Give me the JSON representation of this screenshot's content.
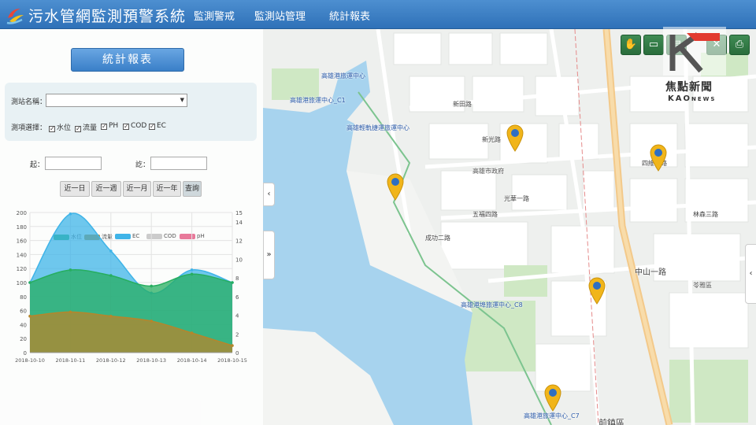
{
  "app": {
    "title": "污水管網監測預警系統"
  },
  "nav": [
    {
      "label": "監測警戒"
    },
    {
      "label": "監測站管理"
    },
    {
      "label": "統計報表"
    }
  ],
  "panel": {
    "report_button": "統計報表",
    "station_label": "測站名稱：",
    "station_value": "",
    "item_label": "測項選擇：",
    "items": [
      {
        "label": "水位",
        "checked": true
      },
      {
        "label": "流量",
        "checked": true
      },
      {
        "label": "PH",
        "checked": true
      },
      {
        "label": "COD",
        "checked": true
      },
      {
        "label": "EC",
        "checked": true
      }
    ],
    "start_label": "起：",
    "end_label": "訖：",
    "start_value": "",
    "end_value": "",
    "range_buttons": [
      {
        "label": "近一日"
      },
      {
        "label": "近一週"
      },
      {
        "label": "近一月"
      },
      {
        "label": "近一年"
      },
      {
        "label": "查詢"
      }
    ]
  },
  "chart_data": {
    "type": "area",
    "x": [
      "2018-10-10",
      "2018-10-11",
      "2018-10-12",
      "2018-10-13",
      "2018-10-14",
      "2018-10-15"
    ],
    "y_left_ticks": [
      0,
      20,
      40,
      60,
      80,
      100,
      120,
      140,
      160,
      180,
      200
    ],
    "y_right_ticks": [
      0,
      2,
      4,
      6,
      8,
      10,
      12,
      14,
      15
    ],
    "ylim_left": [
      0,
      200
    ],
    "ylim_right": [
      0,
      15
    ],
    "series": [
      {
        "name": "水位",
        "color": "#27ae60",
        "axis": "left",
        "values": [
          100,
          118,
          110,
          95,
          112,
          100
        ]
      },
      {
        "name": "流量",
        "color": "#b5862b",
        "axis": "left",
        "values": [
          52,
          58,
          52,
          45,
          28,
          10
        ]
      },
      {
        "name": "EC",
        "color": "#3fb4e8",
        "axis": "left",
        "values": [
          100,
          198,
          145,
          85,
          118,
          100
        ]
      },
      {
        "name": "COD",
        "color": "#cccccc",
        "axis": "right",
        "values": []
      },
      {
        "name": "pH",
        "color": "#e8799a",
        "axis": "right",
        "values": []
      }
    ],
    "grid": true
  },
  "map_labels": [
    "高雄港旅運中心",
    "高雄港旅運中心_C1",
    "高雄輕軌捷運旅運中心",
    "高雄港埠旅運中心_C8",
    "高雄港旅運中心_C7",
    "中山一路",
    "前鎮區",
    "苓雅區",
    "高雄市政府",
    "成功二路",
    "四維三路",
    "新光路",
    "林森三路",
    "光華一路",
    "新田路",
    "五福四路"
  ],
  "toolbar": [
    {
      "icon": "hand-icon",
      "glyph": "✋"
    },
    {
      "icon": "ruler-icon",
      "glyph": "▭"
    },
    {
      "icon": "layers-icon",
      "glyph": "▤"
    },
    {
      "icon": "close-icon",
      "glyph": "✕"
    },
    {
      "icon": "print-icon",
      "glyph": "⎙"
    }
  ],
  "watermark": {
    "line1": "焦點新聞",
    "line2": "KAO",
    "line2b": "NEWS"
  },
  "side_tabs": {
    "collapse": "‹",
    "expand": "»",
    "right": "‹"
  },
  "colors": {
    "header": "#3a7fc4",
    "water": "#a7d3ee",
    "park": "#cfe8c4",
    "pin": "#f1b51a"
  }
}
